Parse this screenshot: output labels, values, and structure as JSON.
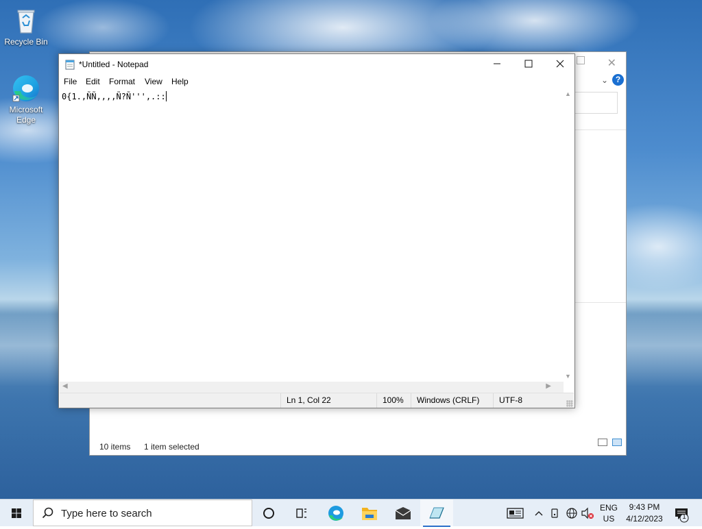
{
  "desktop": {
    "icons": [
      {
        "label": "Recycle Bin"
      },
      {
        "label_line1": "Microsoft",
        "label_line2": "Edge"
      }
    ]
  },
  "explorer": {
    "status_items": "10 items",
    "status_selected": "1 item selected"
  },
  "notepad": {
    "title": "*Untitled - Notepad",
    "menu": [
      "File",
      "Edit",
      "Format",
      "View",
      "Help"
    ],
    "content": "0{1.,ÑÑ,,,,Ñ?Ñ''',.::",
    "status": {
      "position": "Ln 1, Col 22",
      "zoom": "100%",
      "line_ending": "Windows (CRLF)",
      "encoding": "UTF-8"
    }
  },
  "taskbar": {
    "search_placeholder": "Type here to search",
    "pinned": [
      "cortana-icon",
      "task-view-icon",
      "edge-icon",
      "file-explorer-icon",
      "mail-icon",
      "notepad-icon"
    ],
    "tray": {
      "lang_line1": "ENG",
      "lang_line2": "US",
      "time": "9:43 PM",
      "date": "4/12/2023",
      "notification_count": "1"
    }
  },
  "colors": {
    "accent": "#2a6fc9",
    "taskbar_bg": "#e6eef7",
    "help_blue": "#1a6fd1"
  }
}
